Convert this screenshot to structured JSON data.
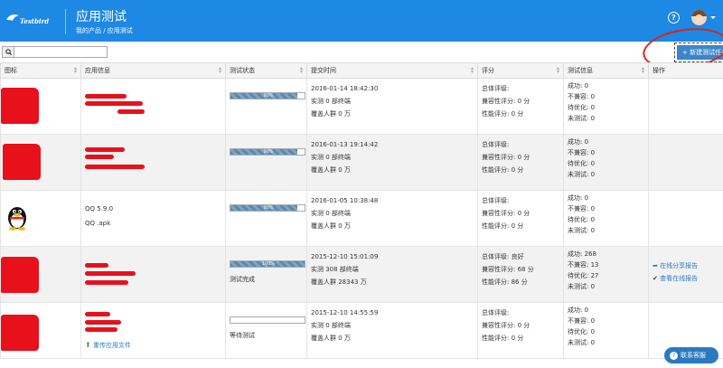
{
  "header": {
    "logo_text": "Testbird",
    "title": "应用测试",
    "breadcrumb": "我的产品 / 应用测试"
  },
  "toolbar": {
    "search_placeholder": "",
    "new_button_label": "+ 新建测试任务"
  },
  "table": {
    "columns": [
      "图标",
      "应用信息",
      "测试状态",
      "提交时间",
      "评分",
      "测试信息",
      "操作"
    ],
    "rows": [
      {
        "app_name": "",
        "app_file": "",
        "progress_label": "90%",
        "progress": 0.9,
        "status_text": "",
        "submit_time": "2016-01-14 18:42:30",
        "measured": "实测 0 部终端",
        "coverage": "覆盖人群 0 万",
        "rating_total": "总体评级:",
        "rating_compat": "兼容性评分: 0 分",
        "rating_perf": "性能评分: 0 分",
        "info_success": "成功: 0",
        "info_incompat": "不兼容: 0",
        "info_optimize": "待优化: 0",
        "info_untested": "未测试: 0"
      },
      {
        "app_name": "",
        "app_file": "",
        "progress_label": "90%",
        "progress": 0.9,
        "status_text": "",
        "submit_time": "2016-01-13 19:14:42",
        "measured": "实测 0 部终端",
        "coverage": "覆盖人群 0 万",
        "rating_total": "总体评级:",
        "rating_compat": "兼容性评分: 0 分",
        "rating_perf": "性能评分: 0 分",
        "info_success": "成功: 0",
        "info_incompat": "不兼容: 0",
        "info_optimize": "待优化: 0",
        "info_untested": "未测试: 0"
      },
      {
        "app_name": "QQ 5.9.0",
        "app_file": "QQ .apk",
        "progress_label": "90%",
        "progress": 0.9,
        "status_text": "",
        "submit_time": "2016-01-05 10:38:48",
        "measured": "实测 0 部终端",
        "coverage": "覆盖人群 0 万",
        "rating_total": "总体评级:",
        "rating_compat": "兼容性评分: 0 分",
        "rating_perf": "性能评分: 0 分",
        "info_success": "成功: 0",
        "info_incompat": "不兼容: 0",
        "info_optimize": "待优化: 0",
        "info_untested": "未测试: 0"
      },
      {
        "app_name": "",
        "app_file": "",
        "progress_label": "100%",
        "progress": 1.0,
        "status_text": "测试完成",
        "submit_time": "2015-12-10 15:01:09",
        "measured": "实测 308 部终端",
        "coverage": "覆盖人群 28343 万",
        "rating_total": "总体评级: 良好",
        "rating_compat": "兼容性评分: 68 分",
        "rating_perf": "性能评分: 86 分",
        "info_success": "成功: 268",
        "info_incompat": "不兼容: 13",
        "info_optimize": "待优化: 27",
        "info_untested": "未测试: 0",
        "action_share": "在线分享报告",
        "action_view": "查看在线报告"
      },
      {
        "app_name": "",
        "app_file": "",
        "progress_label": "",
        "progress": 0.0,
        "status_text": "等待测试",
        "reupload": "重传应用文件",
        "submit_time": "2015-12-10 14:55:59",
        "measured": "实测 0 部终端",
        "coverage": "覆盖人群 0 万",
        "rating_total": "总体评级:",
        "rating_compat": "兼容性评分: 0 分",
        "rating_perf": "性能评分: 0 分",
        "info_success": "成功: 0",
        "info_incompat": "不兼容: 0",
        "info_optimize": "待优化: 0",
        "info_untested": "未测试: 0"
      }
    ]
  },
  "chat": {
    "label": "联系客服"
  },
  "colors": {
    "header": "#1d89e4",
    "accent": "#3a86c8",
    "redact": "#e8101b",
    "annotation": "#d8241b"
  }
}
